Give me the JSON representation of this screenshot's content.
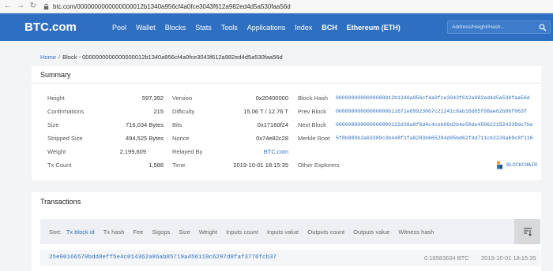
{
  "browser": {
    "url": "btc.com/0000000000000000012b1340a956cf4a0fce3043f612a982ed4d5a530faa56d"
  },
  "header": {
    "logo": "BTC.com",
    "nav": [
      "Pool",
      "Wallet",
      "Blocks",
      "Stats",
      "Tools",
      "Applications",
      "Index",
      "BCH",
      "Ethereum (ETH)"
    ],
    "search_placeholder": "Address/Height/Hash..."
  },
  "breadcrumb": {
    "home": "Home",
    "separator": "/",
    "current": "Block - 0000000000000000012b1340a956cf4a0fce3043f612a982ed4d5a530faa56d"
  },
  "summary": {
    "title": "Summary",
    "col1": [
      {
        "label": "Height",
        "value": "597,392"
      },
      {
        "label": "Confirmations",
        "value": "215"
      },
      {
        "label": "Size",
        "value": "716,034 Bytes"
      },
      {
        "label": "Stripped Size",
        "value": "494,525 Bytes"
      },
      {
        "label": "Weight",
        "value": "2,199,609"
      },
      {
        "label": "Tx Count",
        "value": "1,588"
      }
    ],
    "col2": [
      {
        "label": "Version",
        "value": "0x20400000"
      },
      {
        "label": "Difficulty",
        "value": "15.06 T / 12.76 T"
      },
      {
        "label": "Bits",
        "value": "0x17160f24"
      },
      {
        "label": "Nonce",
        "value": "0x74e82c28"
      },
      {
        "label": "Relayed By",
        "value": "BTC.com"
      },
      {
        "label": "Time",
        "value": "2019-10-01 18:15:35"
      }
    ],
    "col3": [
      {
        "label": "Block Hash",
        "value": "0000000000000000012b1340a956cf4a0fce3043f612a982ed4d5a530faa56d"
      },
      {
        "label": "Prev Block",
        "value": "00000000000000000b11671e69923067c21241c8ab16d65f08ae62b86f063f"
      },
      {
        "label": "Next Block",
        "value": "000000000000000000122d38a0f6d4c4ceb69d2b4e50de4506221524339dc7be"
      },
      {
        "label": "Merkle Root",
        "value": "5f0b889b2a63389c3b448f1fa8283b665284d05bd62fdd711cb3220a69c8f116"
      },
      {
        "label": "Other Explorers",
        "value": "BLOCKCHAIR"
      }
    ]
  },
  "transactions": {
    "title": "Transactions",
    "sort_label": "Sort:",
    "sort_options": [
      "Tx block id",
      "Tx hash",
      "Fee",
      "Sigops",
      "Size",
      "Weight",
      "Inputs count",
      "Inputs value",
      "Outputs count",
      "Outputs value",
      "Witness hash"
    ],
    "rows": [
      {
        "hash": "25e00166570bdd8eff5e4c014362a86ab85719a456119c6297d8faf3776fcb37",
        "amount": "0.16583634 BTC",
        "time": "2019-10-01 18:15:35"
      }
    ]
  },
  "colors": {
    "brand": "#2f6fc1",
    "background": "#f3f4f6"
  }
}
